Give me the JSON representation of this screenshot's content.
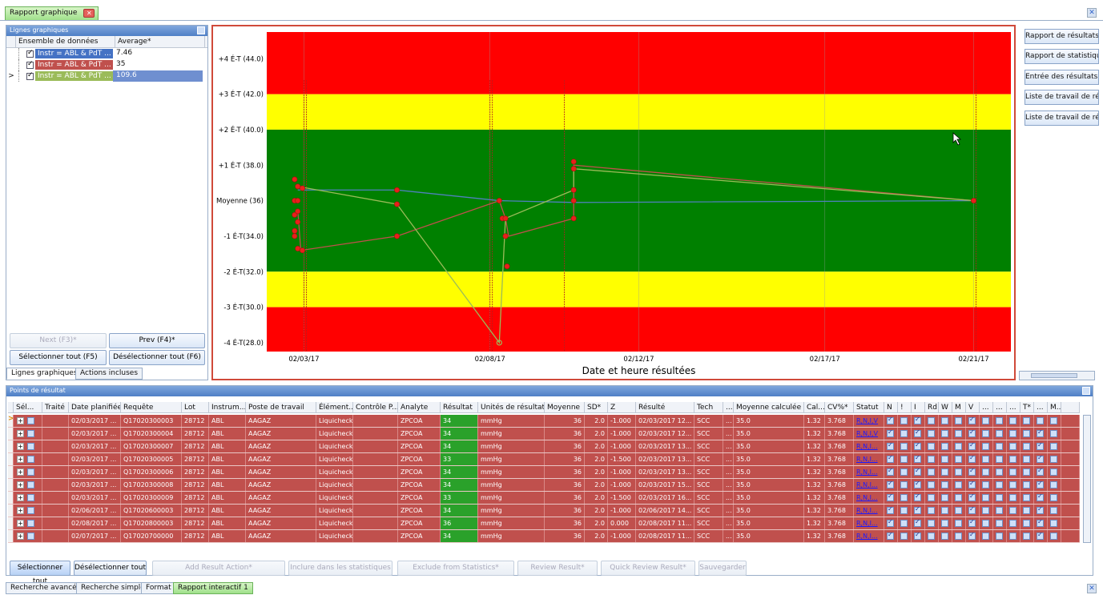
{
  "app": {
    "tab_title": "Rapport graphique"
  },
  "left_panel": {
    "title": "Lignes graphiques",
    "col_dataset": "Ensemble de données",
    "col_average": "Average*",
    "rows": [
      {
        "label": "Instr = ABL & PdT ...",
        "value": "7.46",
        "color": "#4472c4"
      },
      {
        "label": "Instr = ABL & PdT ...",
        "value": "35",
        "color": "#c0504d"
      },
      {
        "label": "Instr = ABL & PdT ...",
        "value": "109.6",
        "color": "#9bbb59"
      }
    ],
    "next_label": "Next (F3)*",
    "prev_label": "Prev (F4)*",
    "select_all_label": "Sélectionner tout (F5)",
    "deselect_all_label": "Désélectionner tout (F6)",
    "tab1": "Lignes graphiques",
    "tab2": "Actions incluses"
  },
  "right_buttons": [
    "Rapport de résultats",
    "Rapport de statistiques",
    "Entrée des résultats",
    "Liste de travail de résultats",
    "Liste de travail de révision"
  ],
  "chart_data": {
    "type": "line",
    "title": "",
    "xlabel": "Date et heure résultées",
    "ylabel": "",
    "ylim": [
      27.5,
      45.5
    ],
    "bands": [
      {
        "from": 42,
        "to": 45.5,
        "color": "#ff0000"
      },
      {
        "from": 40,
        "to": 42,
        "color": "#ffff00"
      },
      {
        "from": 32,
        "to": 40,
        "color": "#008000"
      },
      {
        "from": 30,
        "to": 32,
        "color": "#ffff00"
      },
      {
        "from": 27.5,
        "to": 30,
        "color": "#ff0000"
      }
    ],
    "yticks": [
      {
        "v": 44,
        "label": "+4 É-T (44.0)"
      },
      {
        "v": 42,
        "label": "+3 É-T (42.0)"
      },
      {
        "v": 40,
        "label": "+2 É-T (40.0)"
      },
      {
        "v": 38,
        "label": "+1 É-T (38.0)"
      },
      {
        "v": 36,
        "label": "Moyenne (36)"
      },
      {
        "v": 34,
        "label": "-1 É-T(34.0)"
      },
      {
        "v": 32,
        "label": "-2 É-T(32.0)"
      },
      {
        "v": 30,
        "label": "-3 É-T(30.0)"
      },
      {
        "v": 28,
        "label": "-4 É-T(28.0)"
      }
    ],
    "xlim": [
      "2017-02-02",
      "2017-02-22"
    ],
    "xticks": [
      {
        "d": "2017-02-03",
        "label": "02/03/17"
      },
      {
        "d": "2017-02-08",
        "label": "02/08/17"
      },
      {
        "d": "2017-02-12",
        "label": "02/12/17"
      },
      {
        "d": "2017-02-17",
        "label": "02/17/17"
      },
      {
        "d": "2017-02-21",
        "label": "02/21/17"
      }
    ],
    "vlines": [
      "2017-02-03",
      "2017-02-03",
      "2017-02-08",
      "2017-02-08",
      "2017-02-10",
      "2017-02-21"
    ],
    "series": [
      {
        "color": "#4f81bd",
        "points": [
          [
            "2017-02-02T20:00",
            36.6
          ],
          [
            "2017-02-05T12:00",
            36.6
          ],
          [
            "2017-02-08T06:00",
            36
          ],
          [
            "2017-02-10T06:00",
            35.9
          ],
          [
            "2017-02-21T00:00",
            36
          ]
        ]
      },
      {
        "color": "#c0504d",
        "points": [
          [
            "2017-02-02T20:00",
            35.5
          ],
          [
            "2017-02-02T22:00",
            33.2
          ],
          [
            "2017-02-05T12:00",
            34
          ],
          [
            "2017-02-08T06:00",
            36
          ],
          [
            "2017-02-08T10:00",
            35
          ],
          [
            "2017-02-08T12:00",
            34
          ],
          [
            "2017-02-10T06:00",
            35
          ],
          [
            "2017-02-10T06:00",
            38
          ],
          [
            "2017-02-21T00:00",
            36
          ]
        ]
      },
      {
        "color": "#9bbb59",
        "points": [
          [
            "2017-02-02T20:00",
            36.8
          ],
          [
            "2017-02-05T12:00",
            35.8
          ],
          [
            "2017-02-08T06:00",
            28
          ],
          [
            "2017-02-08T10:00",
            35
          ],
          [
            "2017-02-10T06:00",
            36.6
          ],
          [
            "2017-02-10T06:00",
            37.8
          ],
          [
            "2017-02-21T00:00",
            36
          ]
        ]
      }
    ],
    "markers": [
      [
        "2017-02-02T18:00",
        37.2
      ],
      [
        "2017-02-02T18:00",
        36
      ],
      [
        "2017-02-02T18:00",
        35.2
      ],
      [
        "2017-02-02T18:00",
        34.3
      ],
      [
        "2017-02-02T18:00",
        34
      ],
      [
        "2017-02-02T20:00",
        36.8
      ],
      [
        "2017-02-02T20:00",
        36
      ],
      [
        "2017-02-02T20:00",
        35.4
      ],
      [
        "2017-02-02T20:00",
        34.8
      ],
      [
        "2017-02-02T20:00",
        33.3
      ],
      [
        "2017-02-02T23:00",
        36.7
      ],
      [
        "2017-02-02T23:00",
        33.2
      ],
      [
        "2017-02-05T12:00",
        36.6
      ],
      [
        "2017-02-05T12:00",
        35.8
      ],
      [
        "2017-02-05T12:00",
        34
      ],
      [
        "2017-02-08T06:00",
        36
      ],
      [
        "2017-02-08T08:00",
        35
      ],
      [
        "2017-02-08T10:00",
        35
      ],
      [
        "2017-02-08T10:00",
        34
      ],
      [
        "2017-02-08T11:00",
        32.3
      ],
      [
        "2017-02-10T06:00",
        38.2
      ],
      [
        "2017-02-10T06:00",
        37.8
      ],
      [
        "2017-02-10T06:00",
        36.6
      ],
      [
        "2017-02-10T06:00",
        36
      ],
      [
        "2017-02-10T06:00",
        35
      ],
      [
        "2017-02-21T00:00",
        36
      ]
    ]
  },
  "grid": {
    "title": "Points de résultat",
    "headers": [
      "Sél...",
      "Traité",
      "Date planifiée",
      "Requête",
      "Lot",
      "Instrum...",
      "Poste de travail",
      "Élément...",
      "Contrôle P...",
      "Analyte",
      "Résultat",
      "Unités de résultat",
      "Moyenne",
      "SD*",
      "Z",
      "Résulté",
      "Tech",
      "...",
      "Moyenne calculée",
      "Cal...",
      "CV%*",
      "Statut",
      "N",
      "!",
      "I",
      "Rd",
      "W",
      "M",
      "V",
      "...",
      "...",
      "...",
      "T*",
      "...",
      "M..."
    ],
    "rows": [
      {
        "date": "02/03/2017 ...",
        "req": "Q17020300003",
        "lot": "28712",
        "inst": "ABL",
        "poste": "AAGAZ",
        "elem": "Liquicheck2",
        "analyte": "ZPCOA",
        "res": "34",
        "unit": "mmHg",
        "moy": "36",
        "sd": "2.0",
        "z": "-1.000",
        "resulte": "02/03/2017 12...",
        "tech": "SCC",
        "dots": "...",
        "moycalc": "35.0",
        "cal": "1.32",
        "cv": "3.768",
        "statut": "R,N,I,V"
      },
      {
        "date": "02/03/2017 ...",
        "req": "Q17020300004",
        "lot": "28712",
        "inst": "ABL",
        "poste": "AAGAZ",
        "elem": "Liquicheck2",
        "analyte": "ZPCOA",
        "res": "34",
        "unit": "mmHg",
        "moy": "36",
        "sd": "2.0",
        "z": "-1.000",
        "resulte": "02/03/2017 12...",
        "tech": "SCC",
        "dots": "...",
        "moycalc": "35.0",
        "cal": "1.32",
        "cv": "3.768",
        "statut": "R,N,I,V"
      },
      {
        "date": "02/03/2017 ...",
        "req": "Q17020300007",
        "lot": "28712",
        "inst": "ABL",
        "poste": "AAGAZ",
        "elem": "Liquicheck2",
        "analyte": "ZPCOA",
        "res": "34",
        "unit": "mmHg",
        "moy": "36",
        "sd": "2.0",
        "z": "-1.000",
        "resulte": "02/03/2017 13...",
        "tech": "SCC",
        "dots": "...",
        "moycalc": "35.0",
        "cal": "1.32",
        "cv": "3.768",
        "statut": "R,N,I..."
      },
      {
        "date": "02/03/2017 ...",
        "req": "Q17020300005",
        "lot": "28712",
        "inst": "ABL",
        "poste": "AAGAZ",
        "elem": "Liquicheck2",
        "analyte": "ZPCOA",
        "res": "33",
        "unit": "mmHg",
        "moy": "36",
        "sd": "2.0",
        "z": "-1.500",
        "resulte": "02/03/2017 13...",
        "tech": "SCC",
        "dots": "...",
        "moycalc": "35.0",
        "cal": "1.32",
        "cv": "3.768",
        "statut": "R,N,I..."
      },
      {
        "date": "02/03/2017 ...",
        "req": "Q17020300006",
        "lot": "28712",
        "inst": "ABL",
        "poste": "AAGAZ",
        "elem": "Liquicheck2",
        "analyte": "ZPCOA",
        "res": "34",
        "unit": "mmHg",
        "moy": "36",
        "sd": "2.0",
        "z": "-1.000",
        "resulte": "02/03/2017 13...",
        "tech": "SCC",
        "dots": "...",
        "moycalc": "35.0",
        "cal": "1.32",
        "cv": "3.768",
        "statut": "R,N,I..."
      },
      {
        "date": "02/03/2017 ...",
        "req": "Q17020300008",
        "lot": "28712",
        "inst": "ABL",
        "poste": "AAGAZ",
        "elem": "Liquicheck2",
        "analyte": "ZPCOA",
        "res": "34",
        "unit": "mmHg",
        "moy": "36",
        "sd": "2.0",
        "z": "-1.000",
        "resulte": "02/03/2017 15...",
        "tech": "SCC",
        "dots": "...",
        "moycalc": "35.0",
        "cal": "1.32",
        "cv": "3.768",
        "statut": "R,N,I..."
      },
      {
        "date": "02/03/2017 ...",
        "req": "Q17020300009",
        "lot": "28712",
        "inst": "ABL",
        "poste": "AAGAZ",
        "elem": "Liquicheck2",
        "analyte": "ZPCOA",
        "res": "33",
        "unit": "mmHg",
        "moy": "36",
        "sd": "2.0",
        "z": "-1.500",
        "resulte": "02/03/2017 16...",
        "tech": "SCC",
        "dots": "...",
        "moycalc": "35.0",
        "cal": "1.32",
        "cv": "3.768",
        "statut": "R,N,I..."
      },
      {
        "date": "02/06/2017 ...",
        "req": "Q17020600003",
        "lot": "28712",
        "inst": "ABL",
        "poste": "AAGAZ",
        "elem": "Liquicheck2",
        "analyte": "ZPCOA",
        "res": "34",
        "unit": "mmHg",
        "moy": "36",
        "sd": "2.0",
        "z": "-1.000",
        "resulte": "02/06/2017 14...",
        "tech": "SCC",
        "dots": "...",
        "moycalc": "35.0",
        "cal": "1.32",
        "cv": "3.768",
        "statut": "R,N,I..."
      },
      {
        "date": "02/08/2017 ...",
        "req": "Q17020800003",
        "lot": "28712",
        "inst": "ABL",
        "poste": "AAGAZ",
        "elem": "Liquicheck2",
        "analyte": "ZPCOA",
        "res": "36",
        "unit": "mmHg",
        "moy": "36",
        "sd": "2.0",
        "z": "0.000",
        "resulte": "02/08/2017 11...",
        "tech": "SCC",
        "dots": "...",
        "moycalc": "35.0",
        "cal": "1.32",
        "cv": "3.768",
        "statut": "R,N,I..."
      },
      {
        "date": "02/07/2017 ...",
        "req": "Q17020700000",
        "lot": "28712",
        "inst": "ABL",
        "poste": "AAGAZ",
        "elem": "Liquicheck2",
        "analyte": "ZPCOA",
        "res": "34",
        "unit": "mmHg",
        "moy": "36",
        "sd": "2.0",
        "z": "-1.000",
        "resulte": "02/08/2017 11...",
        "tech": "SCC",
        "dots": "...",
        "moycalc": "35.0",
        "cal": "1.32",
        "cv": "3.768",
        "statut": "R,N,I..."
      }
    ],
    "checks": [
      1,
      0,
      1,
      0,
      0,
      0,
      1,
      0,
      0,
      0,
      0,
      1,
      0
    ],
    "checks_first_row": [
      1,
      0,
      1,
      0,
      0,
      0,
      1,
      0,
      0,
      0,
      0,
      0,
      0
    ]
  },
  "bottom_buttons": {
    "select_all": "Sélectionner tout",
    "deselect_all": "Désélectionner tout",
    "add_action": "Add Result Action*",
    "include_stats": "Inclure dans les statistiques",
    "exclude_stats": "Exclude from Statistics*",
    "review": "Review Result*",
    "quick_review": "Quick Review Result*",
    "save": "Sauvegarder"
  },
  "bottom_tabs": [
    "Recherche avancée",
    "Recherche simple",
    "Format",
    "Rapport interactif 1"
  ]
}
